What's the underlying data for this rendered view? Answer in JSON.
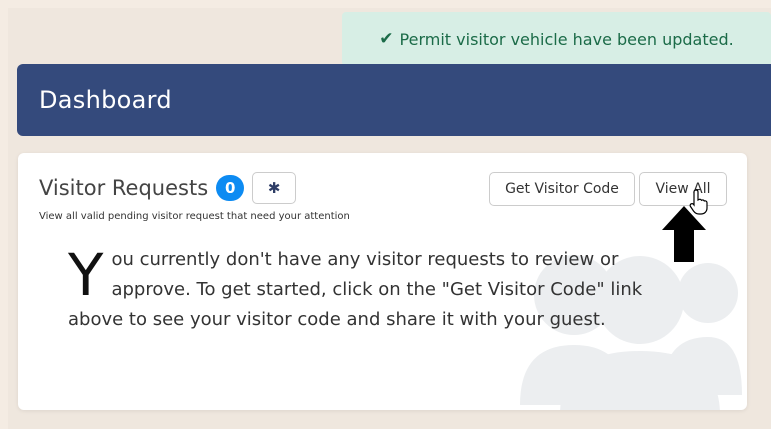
{
  "toast": {
    "icon": "check-icon",
    "message": "Permit visitor vehicle have been updated.",
    "color": "#1b6b48"
  },
  "header": {
    "title": "Dashboard",
    "color": "#344a7c"
  },
  "visitor_requests": {
    "title": "Visitor Requests",
    "count": "0",
    "settings_icon": "gear-icon",
    "subtitle": "View all valid pending visitor request that need your attention",
    "get_code_label": "Get Visitor Code",
    "view_all_label": "View All",
    "empty_dropcap": "Y",
    "empty_message": "ou currently don't have any visitor requests to review or approve. To get started, click on the \"Get Visitor Code\" link above to see your visitor code and share it with your guest.",
    "background_icon": "users-icon",
    "badge_color": "#0d8bf2"
  },
  "annotations": {
    "arrow_icon": "arrow-up-icon",
    "cursor_icon": "hand-pointer-icon"
  }
}
